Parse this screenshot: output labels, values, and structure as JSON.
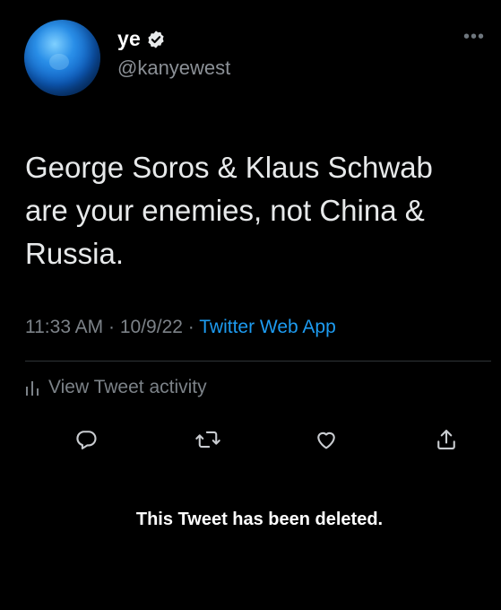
{
  "author": {
    "display_name": "ye",
    "handle": "@kanyewest",
    "verified": true
  },
  "tweet": {
    "text": "George Soros & Klaus Schwab are your enemies, not China & Russia.",
    "time": "11:33 AM",
    "separator": "·",
    "date": "10/9/22",
    "source": "Twitter Web App"
  },
  "activity": {
    "label": "View Tweet activity"
  },
  "actions": [
    {
      "icon": "reply-icon"
    },
    {
      "icon": "retweet-icon"
    },
    {
      "icon": "like-icon"
    },
    {
      "icon": "share-icon"
    }
  ],
  "overlay": {
    "deleted_notice": "This Tweet has been deleted."
  },
  "colors": {
    "background": "#000000",
    "text": "#e7e9ea",
    "secondary": "#7c8288",
    "link": "#1d9bf0",
    "verified_badge": "#e7e9ea"
  }
}
